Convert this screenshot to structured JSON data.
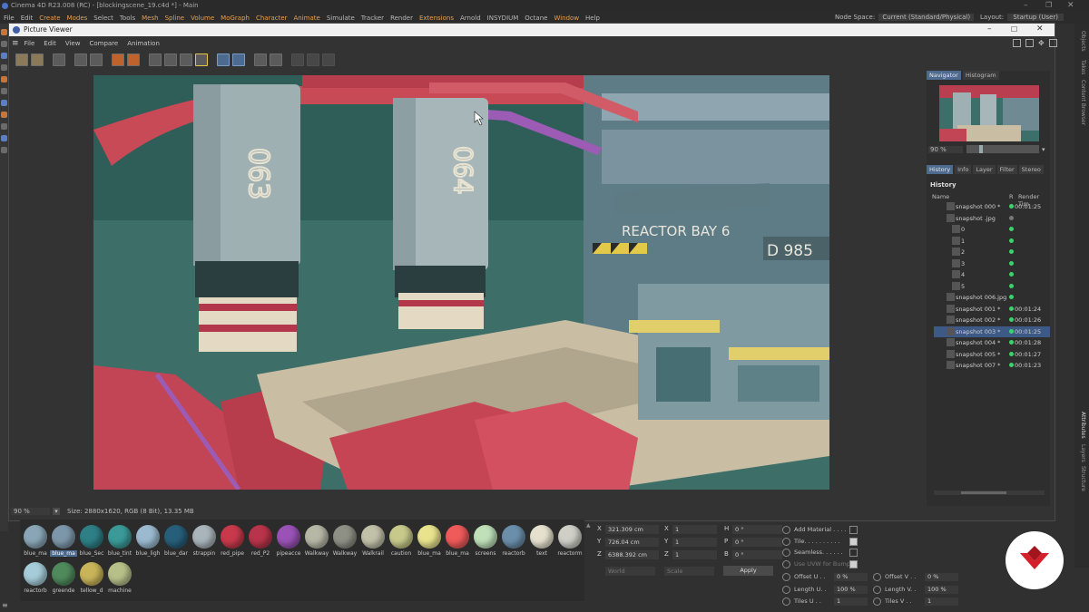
{
  "app": {
    "title": "Cinema 4D R23.008 (RC) - [blockingscene_19.c4d *] - Main",
    "menu": [
      {
        "label": "File",
        "hi": false
      },
      {
        "label": "Edit",
        "hi": false
      },
      {
        "label": "Create",
        "hi": true
      },
      {
        "label": "Modes",
        "hi": true
      },
      {
        "label": "Select",
        "hi": false
      },
      {
        "label": "Tools",
        "hi": false
      },
      {
        "label": "Mesh",
        "hi": true
      },
      {
        "label": "Spline",
        "hi": true
      },
      {
        "label": "Volume",
        "hi": true
      },
      {
        "label": "MoGraph",
        "hi": true
      },
      {
        "label": "Character",
        "hi": true
      },
      {
        "label": "Animate",
        "hi": true
      },
      {
        "label": "Simulate",
        "hi": false
      },
      {
        "label": "Tracker",
        "hi": false
      },
      {
        "label": "Render",
        "hi": false
      },
      {
        "label": "Extensions",
        "hi": true
      },
      {
        "label": "Arnold",
        "hi": false
      },
      {
        "label": "INSYDIUM",
        "hi": false
      },
      {
        "label": "Octane",
        "hi": false
      },
      {
        "label": "Window",
        "hi": true
      },
      {
        "label": "Help",
        "hi": false
      }
    ],
    "node_space_label": "Node Space:",
    "node_space_value": "Current (Standard/Physical)",
    "layout_label": "Layout:",
    "layout_value": "Startup (User)",
    "right_tabs": [
      "Objects",
      "Takes",
      "Content Browser",
      "Attributes",
      "Layers",
      "Structure"
    ]
  },
  "picture_viewer": {
    "title": "Picture Viewer",
    "menu": [
      "File",
      "Edit",
      "View",
      "Compare",
      "Animation"
    ],
    "zoom": "90 %",
    "size_info": "Size: 2880x1620, RGB (8 Bit), 13.35 MB",
    "render_text": {
      "tank1": "063",
      "tank2": "064",
      "sign": "REACTOR BAY 6",
      "code": "D 985"
    },
    "navigator": {
      "tabs": [
        "Navigator",
        "Histogram"
      ],
      "zoom": "90 %"
    },
    "history": {
      "tabs": [
        "History",
        "Info",
        "Layer",
        "Filter",
        "Stereo"
      ],
      "heading": "History",
      "col_name": "Name",
      "col_r": "R",
      "col_time": "Render Tim",
      "rows": [
        {
          "name": "snapshot 000 *",
          "time": "00:01:25",
          "dot": "green",
          "indent": 0,
          "sel": false
        },
        {
          "name": "snapshot .jpg",
          "time": "",
          "dot": "grey",
          "indent": 0,
          "sel": false
        },
        {
          "name": "0",
          "time": "",
          "dot": "green",
          "indent": 1,
          "sel": false
        },
        {
          "name": "1",
          "time": "",
          "dot": "green",
          "indent": 1,
          "sel": false
        },
        {
          "name": "2",
          "time": "",
          "dot": "green",
          "indent": 1,
          "sel": false
        },
        {
          "name": "3",
          "time": "",
          "dot": "green",
          "indent": 1,
          "sel": false
        },
        {
          "name": "4",
          "time": "",
          "dot": "green",
          "indent": 1,
          "sel": false
        },
        {
          "name": "5",
          "time": "",
          "dot": "green",
          "indent": 1,
          "sel": false
        },
        {
          "name": "snapshot 006.jpg",
          "time": "",
          "dot": "green",
          "indent": 0,
          "sel": false
        },
        {
          "name": "snapshot 001 *",
          "time": "00:01:24",
          "dot": "green",
          "indent": 0,
          "sel": false
        },
        {
          "name": "snapshot 002 *",
          "time": "00:01:26",
          "dot": "green",
          "indent": 0,
          "sel": false
        },
        {
          "name": "snapshot 003 *",
          "time": "00:01:25",
          "dot": "green",
          "indent": 0,
          "sel": true
        },
        {
          "name": "snapshot 004 *",
          "time": "00:01:28",
          "dot": "green",
          "indent": 0,
          "sel": false
        },
        {
          "name": "snapshot 005 *",
          "time": "00:01:27",
          "dot": "green",
          "indent": 0,
          "sel": false
        },
        {
          "name": "snapshot 007 *",
          "time": "00:01:23",
          "dot": "green",
          "indent": 0,
          "sel": false
        }
      ]
    }
  },
  "materials": [
    {
      "label": "blue_ma",
      "color": "#8aa6b6",
      "sel": false
    },
    {
      "label": "blue_ma",
      "color": "#7d97aa",
      "sel": true
    },
    {
      "label": "blue_Sec",
      "color": "#2e7f86",
      "sel": false
    },
    {
      "label": "blue_tint",
      "color": "#3b9a98",
      "sel": false
    },
    {
      "label": "blue_ligh",
      "color": "#9bbad0",
      "sel": false
    },
    {
      "label": "blue_dar",
      "color": "#275f7a",
      "sel": false
    },
    {
      "label": "strappin",
      "color": "#a9b4bb",
      "sel": false
    },
    {
      "label": "red_pipe",
      "color": "#c83a4b",
      "sel": false
    },
    {
      "label": "red_P2",
      "color": "#b9344a",
      "sel": false
    },
    {
      "label": "pipeacce",
      "color": "#9a52b6",
      "sel": false
    },
    {
      "label": "Walkway",
      "color": "#b7b7a6",
      "sel": false
    },
    {
      "label": "Walkway",
      "color": "#8e8f85",
      "sel": false
    },
    {
      "label": "Walkrail",
      "color": "#c1c0a9",
      "sel": false
    },
    {
      "label": "caution",
      "color": "#c6c98a",
      "sel": false
    },
    {
      "label": "blue_ma",
      "color": "#e8e38c",
      "sel": false
    },
    {
      "label": "blue_ma",
      "color": "#ef5a5a",
      "sel": false
    },
    {
      "label": "screens",
      "color": "#bfe0b9",
      "sel": false
    },
    {
      "label": "reactorb",
      "color": "#6b8faa",
      "sel": false
    },
    {
      "label": "text",
      "color": "#e6e1cf",
      "sel": false
    },
    {
      "label": "reactorm",
      "color": "#cfcfc8",
      "sel": false
    },
    {
      "label": "reactorb",
      "color": "#a6ccd9",
      "sel": false
    },
    {
      "label": "greende",
      "color": "#4f8a5c",
      "sel": false
    },
    {
      "label": "tellow_d",
      "color": "#c9b45a",
      "sel": false
    },
    {
      "label": "machine",
      "color": "#b8c08a",
      "sel": false
    }
  ],
  "coords": {
    "pos": [
      {
        "axis": "X",
        "value": "321.309 cm"
      },
      {
        "axis": "Y",
        "value": "726.04 cm"
      },
      {
        "axis": "Z",
        "value": "6388.392 cm"
      }
    ],
    "scale": [
      {
        "axis": "X",
        "value": "1"
      },
      {
        "axis": "Y",
        "value": "1"
      },
      {
        "axis": "Z",
        "value": "1"
      }
    ],
    "rot": [
      {
        "axis": "H",
        "value": "0 °"
      },
      {
        "axis": "P",
        "value": "0 °"
      },
      {
        "axis": "B",
        "value": "0 °"
      }
    ],
    "mode1": "World",
    "mode2": "Scale",
    "apply": "Apply"
  },
  "attributes": {
    "checks": [
      {
        "label": "Add Material . . . .",
        "checked": false
      },
      {
        "label": "Tile. . . . . . . . . .",
        "checked": true
      },
      {
        "label": "Seamless. . . . . .",
        "checked": false
      },
      {
        "label": "Use UVW for Bump",
        "checked": true
      }
    ],
    "fields": [
      {
        "label": "Offset U . .",
        "value": "0 %"
      },
      {
        "label": "Offset V . .",
        "value": "0 %"
      },
      {
        "label": "Length U. .",
        "value": "100 %"
      },
      {
        "label": "Length V. .",
        "value": "100 %"
      },
      {
        "label": "Tiles U . .",
        "value": "1"
      },
      {
        "label": "Tiles V . .",
        "value": "1"
      }
    ]
  }
}
